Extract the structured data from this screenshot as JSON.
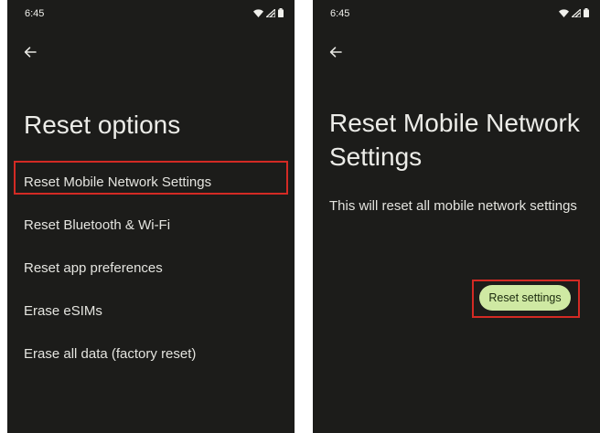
{
  "colors": {
    "screen_bg": "#1c1c1a",
    "text": "#e4e4df",
    "highlight": "#d32a24",
    "button_bg": "#cfe9a3",
    "button_text": "#1b2a0e"
  },
  "left_screen": {
    "status_time": "6:45",
    "back_icon": "arrow-left-icon",
    "title": "Reset options",
    "options": [
      "Reset Mobile Network Settings",
      "Reset Bluetooth & Wi-Fi",
      "Reset app preferences",
      "Erase eSIMs",
      "Erase all data (factory reset)"
    ],
    "highlighted_option": "Reset Mobile Network Settings"
  },
  "right_screen": {
    "status_time": "6:45",
    "back_icon": "arrow-left-icon",
    "title": "Reset Mobile Network Settings",
    "description": "This will reset all mobile network settings",
    "button_label": "Reset settings"
  },
  "status_icons": [
    "wifi-icon",
    "signal-icon",
    "battery-icon"
  ]
}
